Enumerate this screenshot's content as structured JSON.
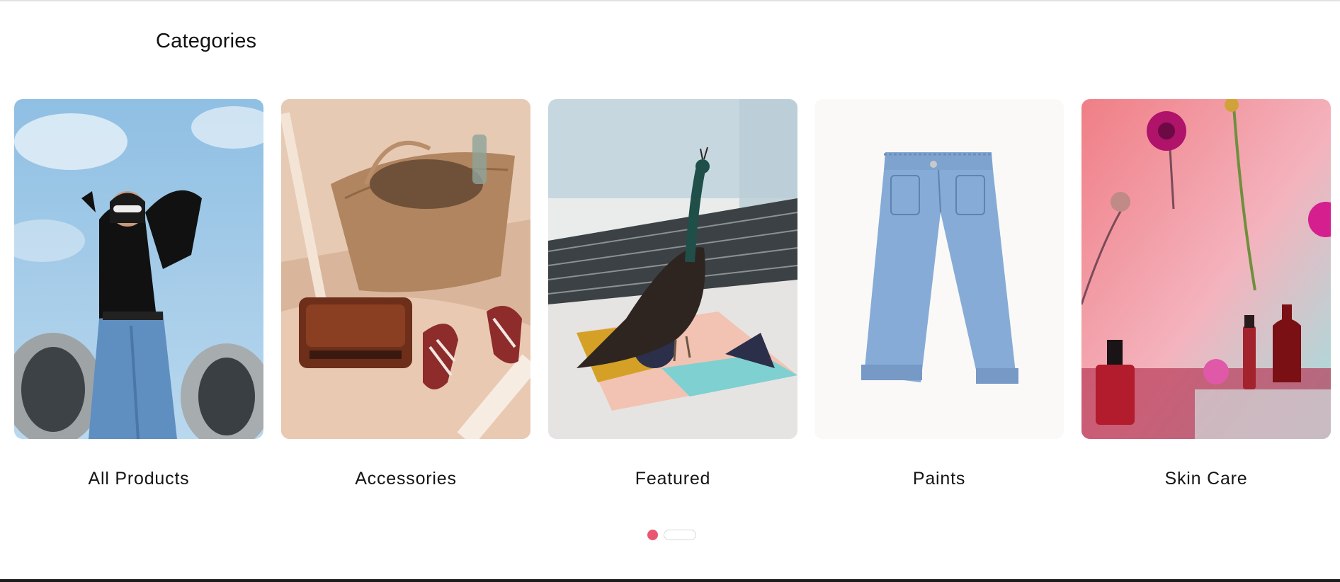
{
  "section": {
    "title": "Categories"
  },
  "categories": [
    {
      "label": "All Products"
    },
    {
      "label": "Accessories"
    },
    {
      "label": "Featured"
    },
    {
      "label": "Paints"
    },
    {
      "label": "Skin Care"
    }
  ],
  "pagination": {
    "pages": 2,
    "active_page": 1
  },
  "colors": {
    "accent": "#e8576f"
  }
}
